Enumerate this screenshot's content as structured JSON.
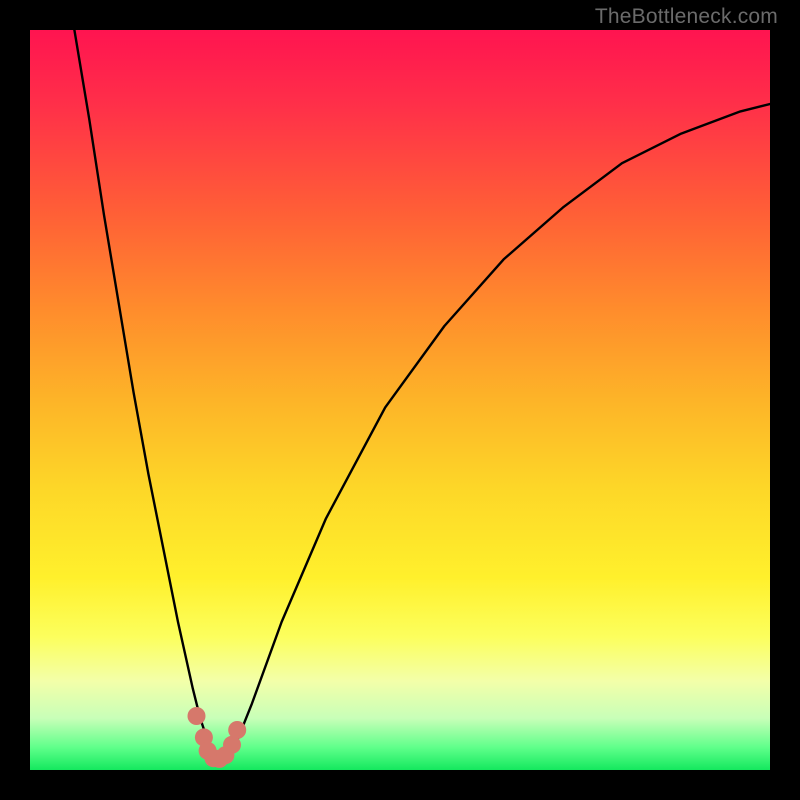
{
  "watermark": "TheBottleneck.com",
  "colors": {
    "frame_background": "#000000",
    "curve_stroke": "#000000",
    "marker_fill": "#d6786b",
    "gradient_stops": [
      {
        "offset": 0.0,
        "color": "#ff1450"
      },
      {
        "offset": 0.1,
        "color": "#ff2f49"
      },
      {
        "offset": 0.25,
        "color": "#ff6036"
      },
      {
        "offset": 0.38,
        "color": "#ff8d2c"
      },
      {
        "offset": 0.5,
        "color": "#fdb428"
      },
      {
        "offset": 0.62,
        "color": "#fdd728"
      },
      {
        "offset": 0.74,
        "color": "#fff02c"
      },
      {
        "offset": 0.82,
        "color": "#fcff5d"
      },
      {
        "offset": 0.88,
        "color": "#f3ffa9"
      },
      {
        "offset": 0.93,
        "color": "#c8ffb8"
      },
      {
        "offset": 0.97,
        "color": "#5eff8a"
      },
      {
        "offset": 1.0,
        "color": "#14e85e"
      }
    ]
  },
  "chart_data": {
    "type": "line",
    "title": "",
    "xlabel": "",
    "ylabel": "",
    "xlim": [
      0,
      100
    ],
    "ylim": [
      0,
      100
    ],
    "note": "No axes or tick labels are rendered. Curve depicts a V-shaped bottleneck-mismatch profile. y-values read as % of plot height from bottom; x-values as % of plot width from left. Values estimated from pixels.",
    "series": [
      {
        "name": "bottleneck-curve",
        "x": [
          6,
          8,
          10,
          12,
          14,
          16,
          18,
          20,
          22,
          23,
          24,
          25,
          26,
          27,
          28,
          30,
          34,
          40,
          48,
          56,
          64,
          72,
          80,
          88,
          96,
          100
        ],
        "y": [
          100,
          88,
          75,
          63,
          51,
          40,
          30,
          20,
          11,
          7,
          4,
          2,
          1.5,
          2,
          4,
          9,
          20,
          34,
          49,
          60,
          69,
          76,
          82,
          86,
          89,
          90
        ]
      }
    ],
    "markers": {
      "name": "highlight-cluster",
      "x": [
        22.5,
        23.5,
        24.0,
        24.8,
        25.6,
        26.4,
        27.3,
        28.0
      ],
      "y": [
        7.3,
        4.4,
        2.6,
        1.6,
        1.5,
        2.0,
        3.4,
        5.4
      ]
    }
  }
}
